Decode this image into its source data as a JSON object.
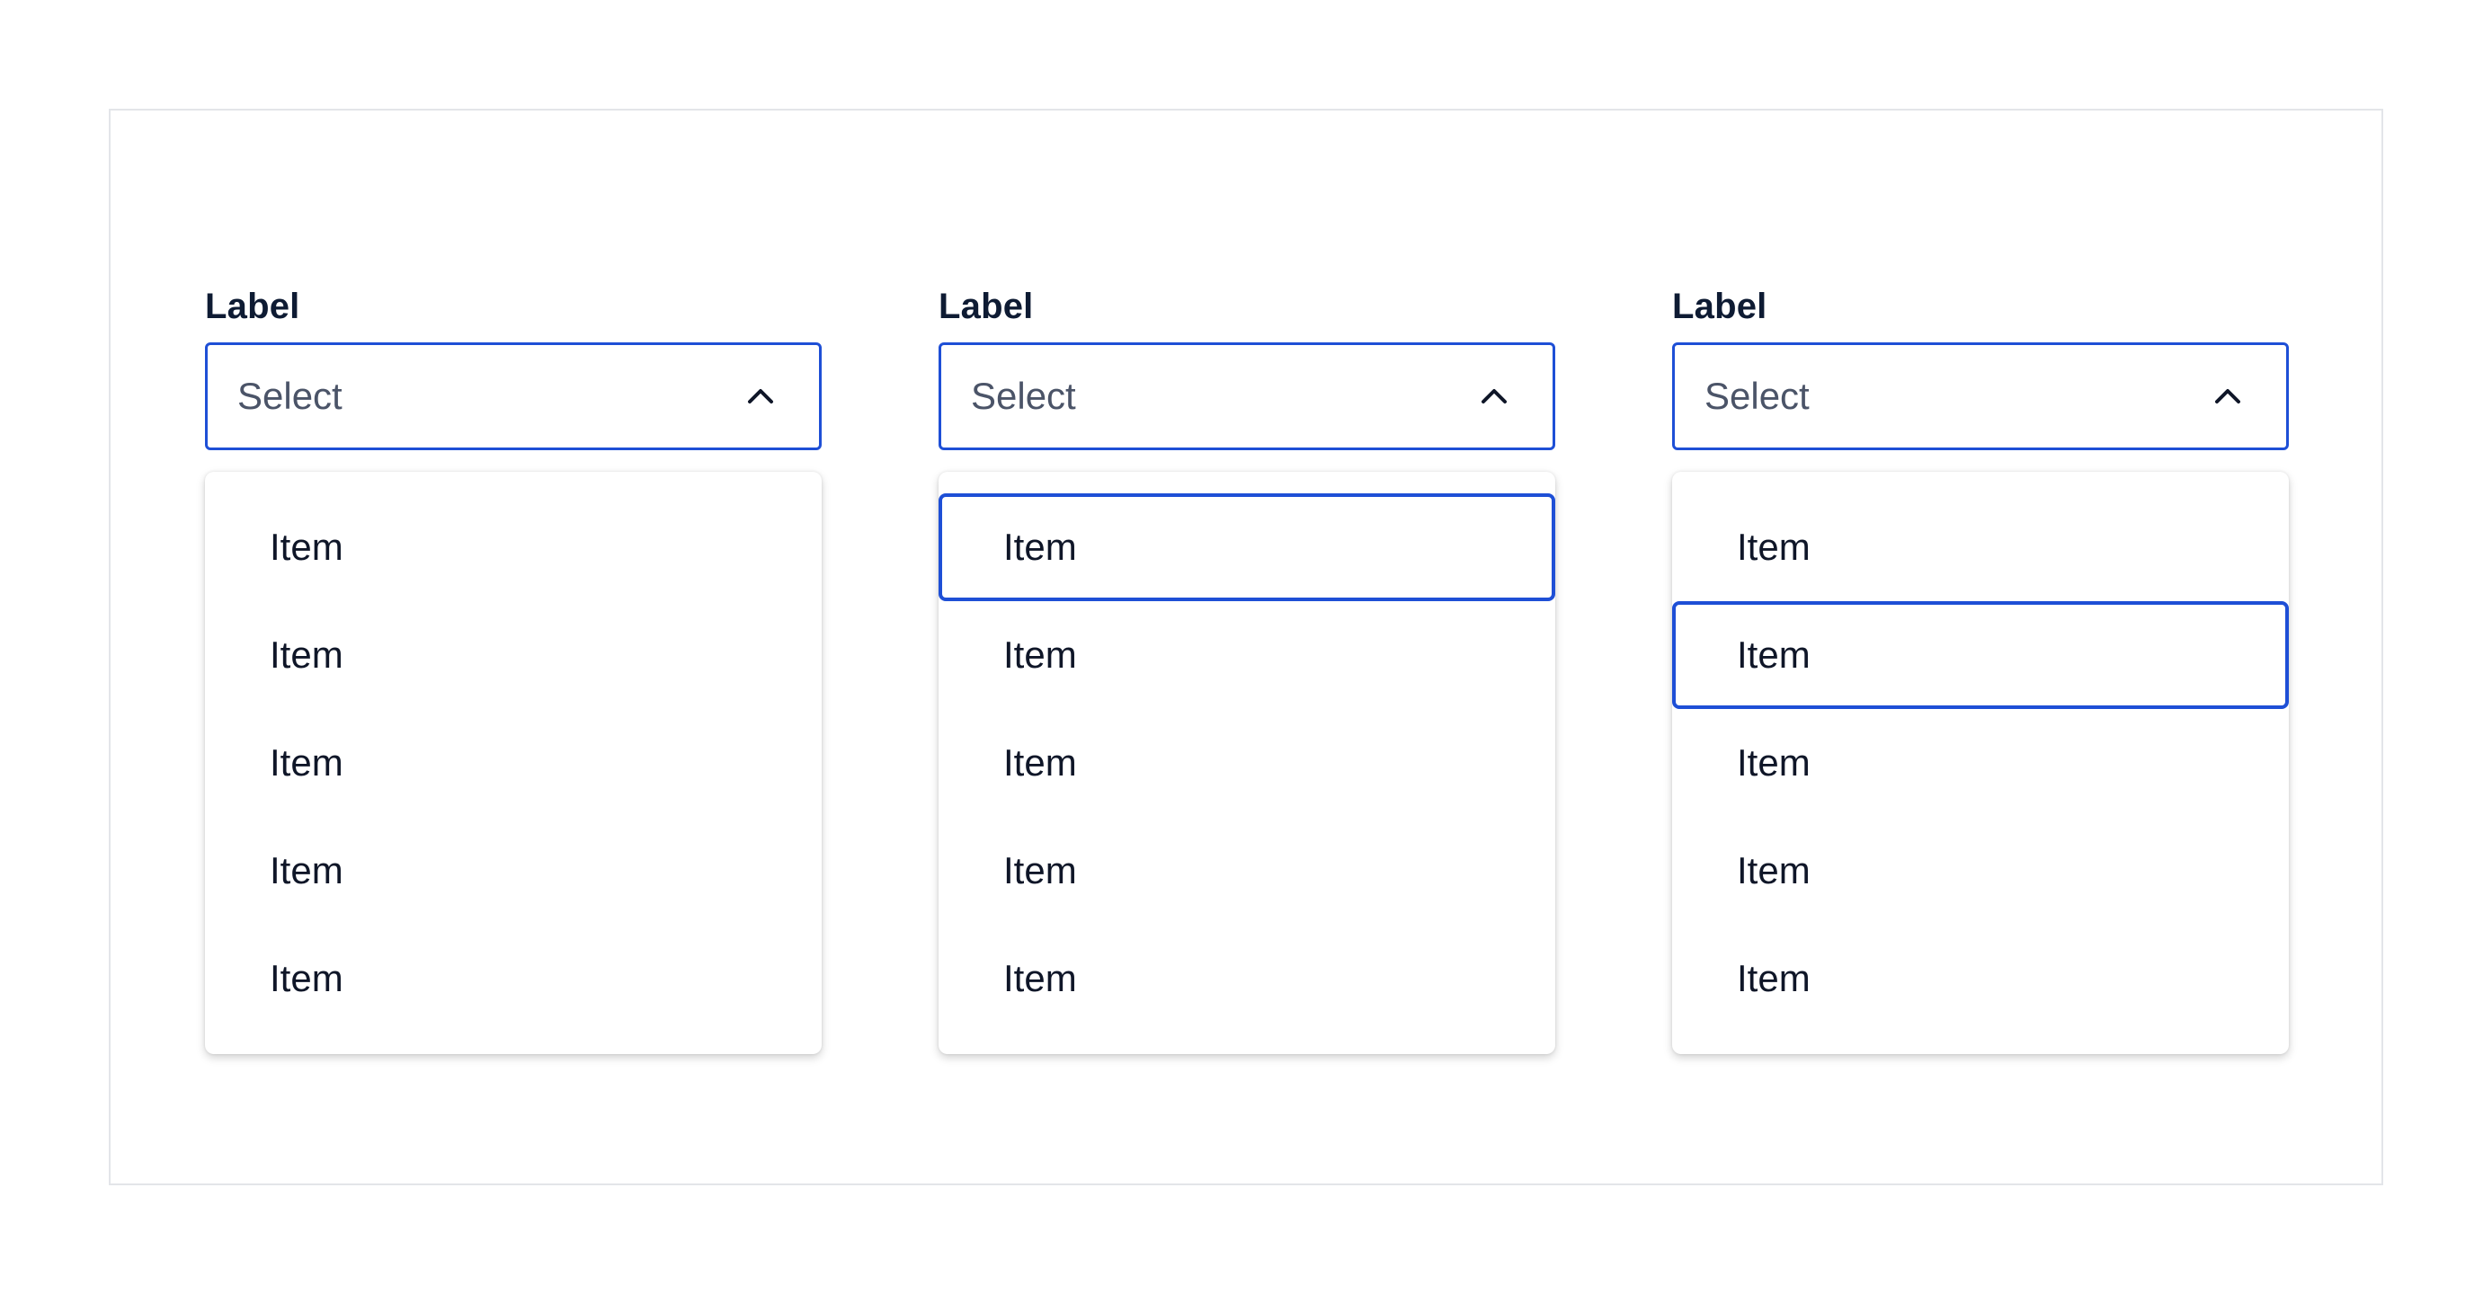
{
  "dropdowns": [
    {
      "label": "Label",
      "placeholder": "Select",
      "icon": "chevron-up-icon",
      "items": [
        "Item",
        "Item",
        "Item",
        "Item",
        "Item"
      ],
      "focused_index": null
    },
    {
      "label": "Label",
      "placeholder": "Select",
      "icon": "chevron-up-icon",
      "items": [
        "Item",
        "Item",
        "Item",
        "Item",
        "Item"
      ],
      "focused_index": 0
    },
    {
      "label": "Label",
      "placeholder": "Select",
      "icon": "chevron-up-icon",
      "items": [
        "Item",
        "Item",
        "Item",
        "Item",
        "Item"
      ],
      "focused_index": 1
    }
  ],
  "colors": {
    "accent": "#1e4fd6",
    "label_text": "#0e1b33",
    "placeholder_text": "#4b5468",
    "item_text": "#0f1628",
    "frame_border": "#e3e5e9"
  }
}
